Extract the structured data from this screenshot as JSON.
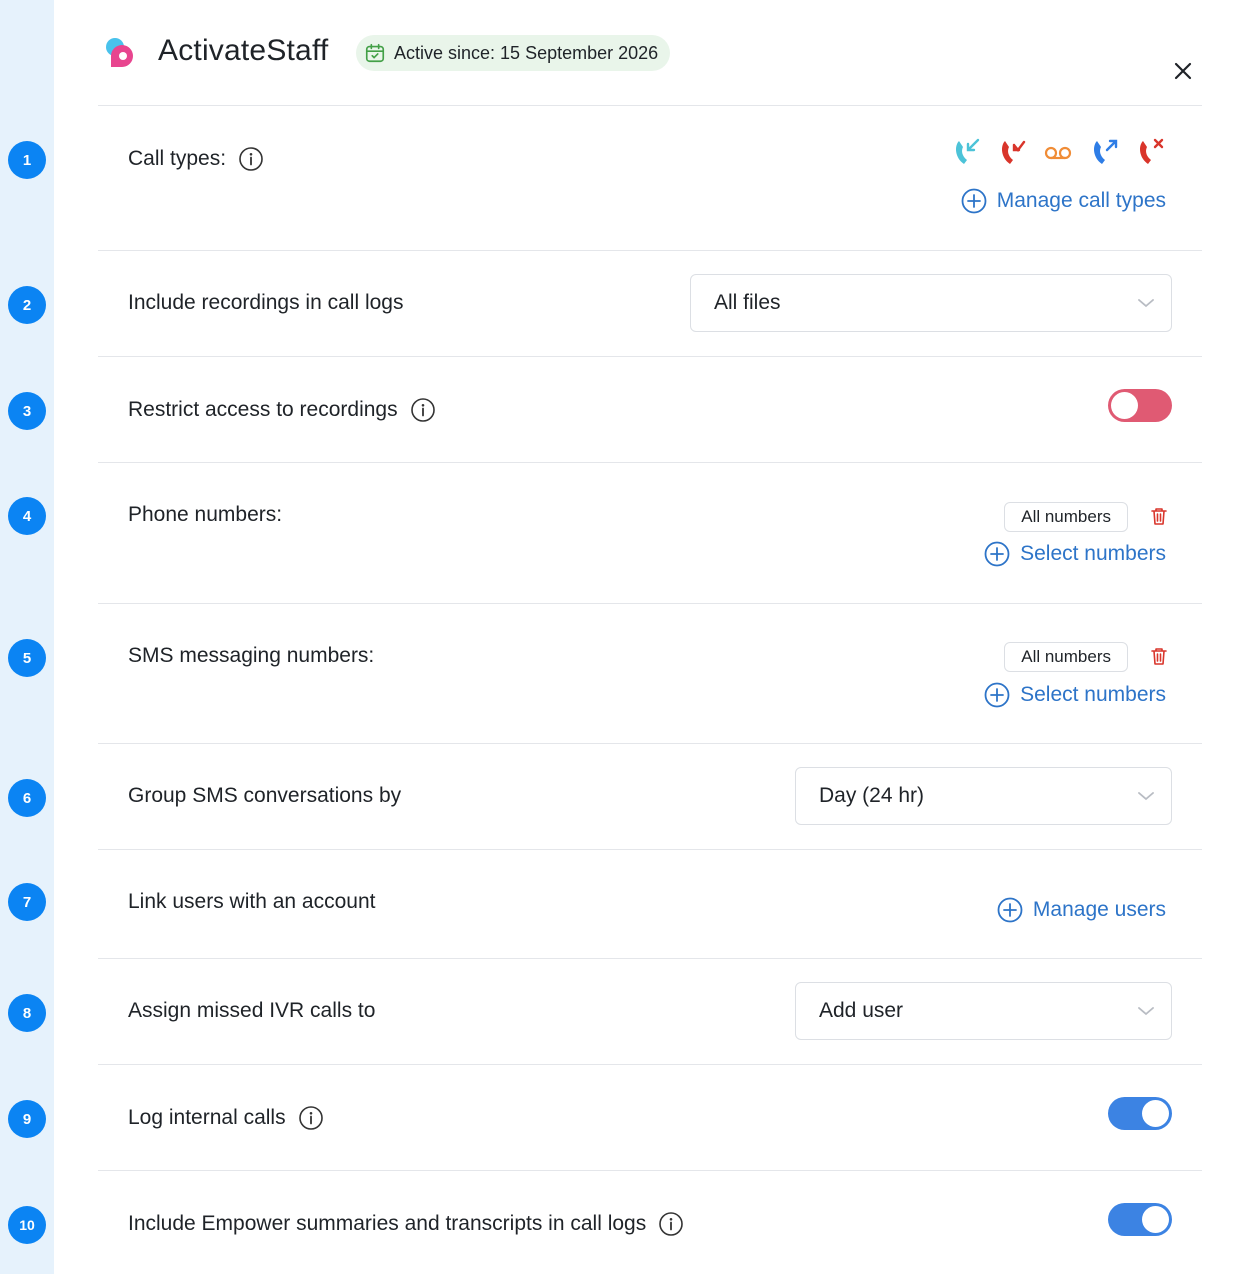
{
  "header": {
    "app_title": "ActivateStaff",
    "active_since": "Active since: 15 September 2026"
  },
  "steps": [
    "1",
    "2",
    "3",
    "4",
    "5",
    "6",
    "7",
    "8",
    "9",
    "10"
  ],
  "rows": {
    "call_types": {
      "label": "Call types:",
      "manage_label": "Manage call types",
      "icons": [
        "incoming-call-icon",
        "missed-call-icon",
        "voicemail-icon",
        "outgoing-call-icon",
        "rejected-call-icon"
      ]
    },
    "recordings": {
      "label": "Include recordings in call logs",
      "value": "All files"
    },
    "restrict": {
      "label": "Restrict access to recordings",
      "enabled": false
    },
    "phone_numbers": {
      "label": "Phone numbers:",
      "chip": "All numbers",
      "select_label": "Select numbers"
    },
    "sms_numbers": {
      "label": "SMS messaging numbers:",
      "chip": "All numbers",
      "select_label": "Select numbers"
    },
    "group_sms": {
      "label": "Group SMS conversations by",
      "value": "Day (24 hr)"
    },
    "link_users": {
      "label": "Link users with an account",
      "manage_label": "Manage users"
    },
    "missed_ivr": {
      "label": "Assign missed IVR calls to",
      "value": "Add user"
    },
    "internal_calls": {
      "label": "Log internal calls",
      "enabled": true
    },
    "empower": {
      "label": "Include Empower summaries and transcripts in call logs",
      "enabled": true
    }
  },
  "colors": {
    "accent": "#2d74c8",
    "badge": "#0b84f3",
    "toggle_on": "#3c83e3",
    "toggle_off": "#e05a73",
    "danger": "#d9352b"
  }
}
